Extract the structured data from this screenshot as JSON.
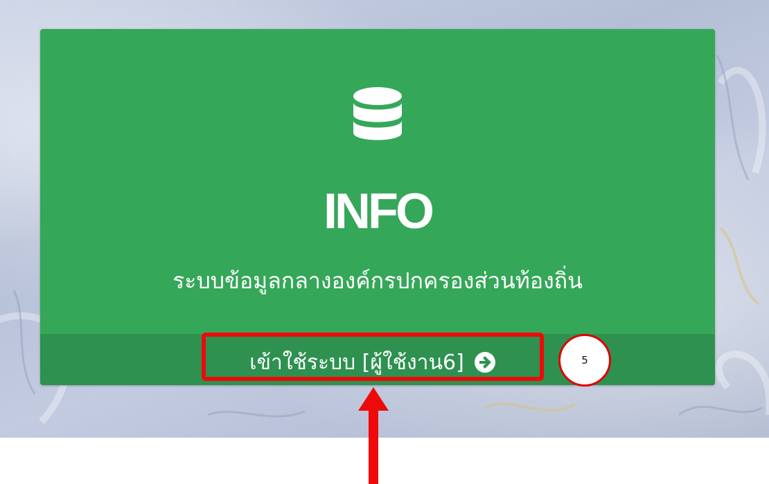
{
  "card": {
    "icon": "database-icon",
    "title": "INFO",
    "subtitle": "ระบบข้อมูลกลางองค์กรปกครองส่วนท้องถิ่น",
    "login_label": "เข้าใช้ระบบ [ผู้ใช้งาน6]",
    "login_icon": "arrow-circle-right-icon"
  },
  "annotation": {
    "step_number": "5",
    "highlight_color": "#ee0a0a",
    "pointer_icon": "red-up-arrow"
  },
  "colors": {
    "card_green": "#35a759",
    "footer_green": "#2e9150"
  }
}
